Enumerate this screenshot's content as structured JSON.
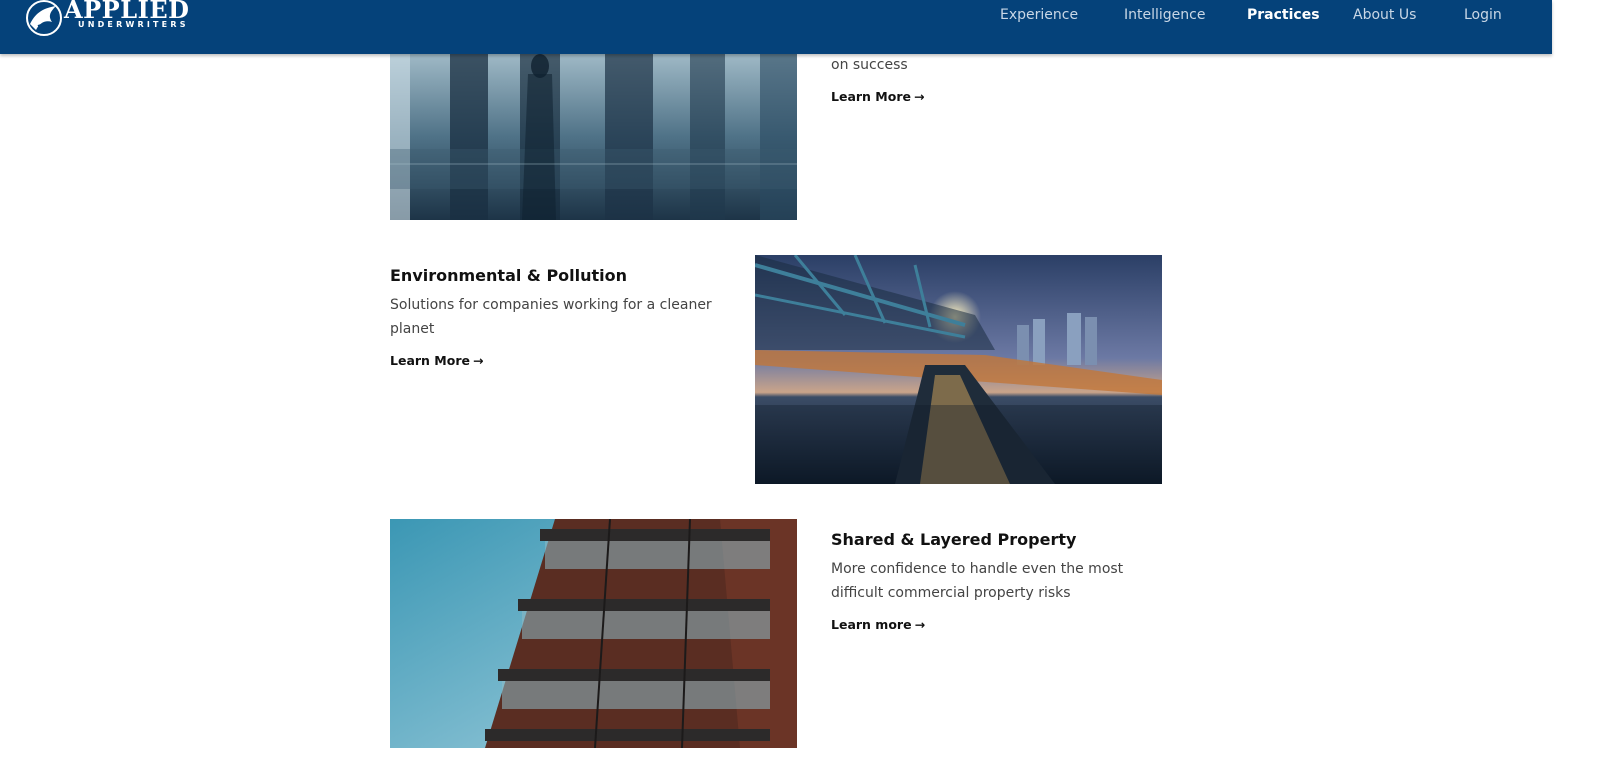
{
  "brand": {
    "name": "APPLIED",
    "sub": "UNDERWRITERS"
  },
  "nav": {
    "items": [
      {
        "label": "Experience",
        "active": false
      },
      {
        "label": "Intelligence",
        "active": false
      },
      {
        "label": "Practices",
        "active": true
      },
      {
        "label": "About Us",
        "active": false
      },
      {
        "label": "Login",
        "active": false
      }
    ]
  },
  "practices": [
    {
      "title": "",
      "desc": "on success",
      "link": "Learn More",
      "arrow": "→",
      "image": "office-skyline-reflection"
    },
    {
      "title": "Environmental & Pollution",
      "desc": "Solutions for companies working for a cleaner planet",
      "link": "Learn More",
      "arrow": "→",
      "image": "water-treatment-plant"
    },
    {
      "title": "Shared & Layered Property",
      "desc": "More confidence to handle even the most difficult commercial property risks",
      "link": "Learn more",
      "arrow": "→",
      "image": "apartment-balconies"
    }
  ],
  "colors": {
    "header_bg": "#05427a",
    "nav_text": "#c9d7e6",
    "active_nav": "#ffffff"
  }
}
